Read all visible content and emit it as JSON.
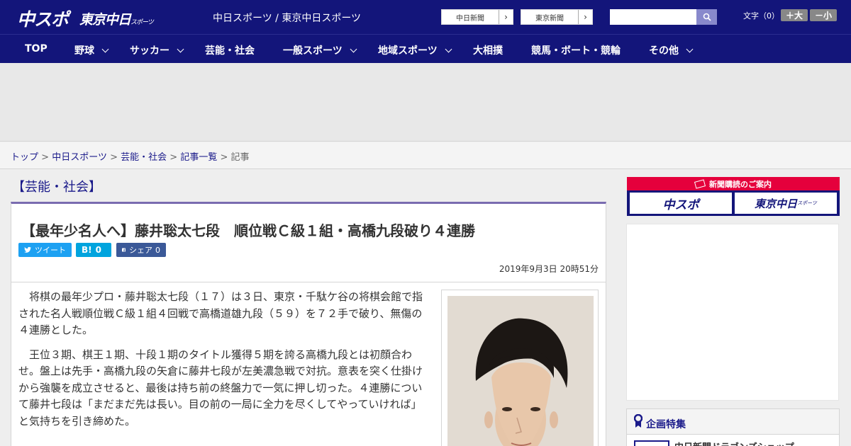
{
  "header": {
    "logo_chuspo": "中スポ",
    "logo_tokyo": "東京中日",
    "logo_tokyo_sub": "スポーツ",
    "site_name": "中日スポーツ / 東京中日スポーツ",
    "link_chunichi": "中日新聞",
    "link_tokyo": "東京新聞",
    "font_size_label": "文字（0）",
    "font_larger": "＋大",
    "font_smaller": "－小",
    "search_placeholder": ""
  },
  "nav": {
    "items": [
      {
        "label": "TOP"
      },
      {
        "label": "野球"
      },
      {
        "label": "サッカー"
      },
      {
        "label": "芸能・社会"
      },
      {
        "label": "一般スポーツ"
      },
      {
        "label": "地域スポーツ"
      },
      {
        "label": "大相撲"
      },
      {
        "label": "競馬・ボート・競輪"
      },
      {
        "label": "その他"
      }
    ]
  },
  "breadcrumb": {
    "items": [
      "トップ",
      "中日スポーツ",
      "芸能・社会",
      "記事一覧"
    ],
    "current": "記事",
    "separator": ">"
  },
  "article": {
    "category": "【芸能・社会】",
    "headline": "【最年少名人へ】藤井聡太七段　順位戦Ｃ級１組・高橋九段破り４連勝",
    "share_tweet": "ツイート",
    "share_hatena_icon": "B!",
    "share_hatena_count": "0",
    "share_fb": "シェア",
    "share_fb_count": "0",
    "date": "2019年9月3日 20時51分",
    "paragraphs": [
      "将棋の最年少プロ・藤井聡太七段（１７）は３日、東京・千駄ケ谷の将棋会館で指された名人戦順位戦Ｃ級１組４回戦で高橋道雄九段（５９）を７２手で破り、無傷の４連勝とした。",
      "王位３期、棋王１期、十段１期のタイトル獲得５期を誇る高橋九段とは初顔合わせ。盤上は先手・高橋九段の矢倉に藤井七段が左美濃急戦で対抗。意表を突く仕掛けから強襲を成立させると、最後は持ち前の終盤力で一気に押し切った。４連勝について藤井七段は「まだまだ先は長い。目の前の一局に全力を尽くしてやっていければ」と気持ちを引き締めた。"
    ]
  },
  "sidebar": {
    "subscription_title": "新聞購読のご案内",
    "subscription_chuspo": "中スポ",
    "subscription_tokyo": "東京中日",
    "subscription_tokyo_sub": "スポーツ",
    "feature_title": "企画特集",
    "feature_item": "中日新聞ドラゴンズショップ"
  },
  "colors": {
    "brand_navy": "#13157a",
    "accent_red": "#e5003c",
    "twitter": "#1da1f2",
    "hatena": "#00a4de",
    "facebook": "#3b5998"
  }
}
